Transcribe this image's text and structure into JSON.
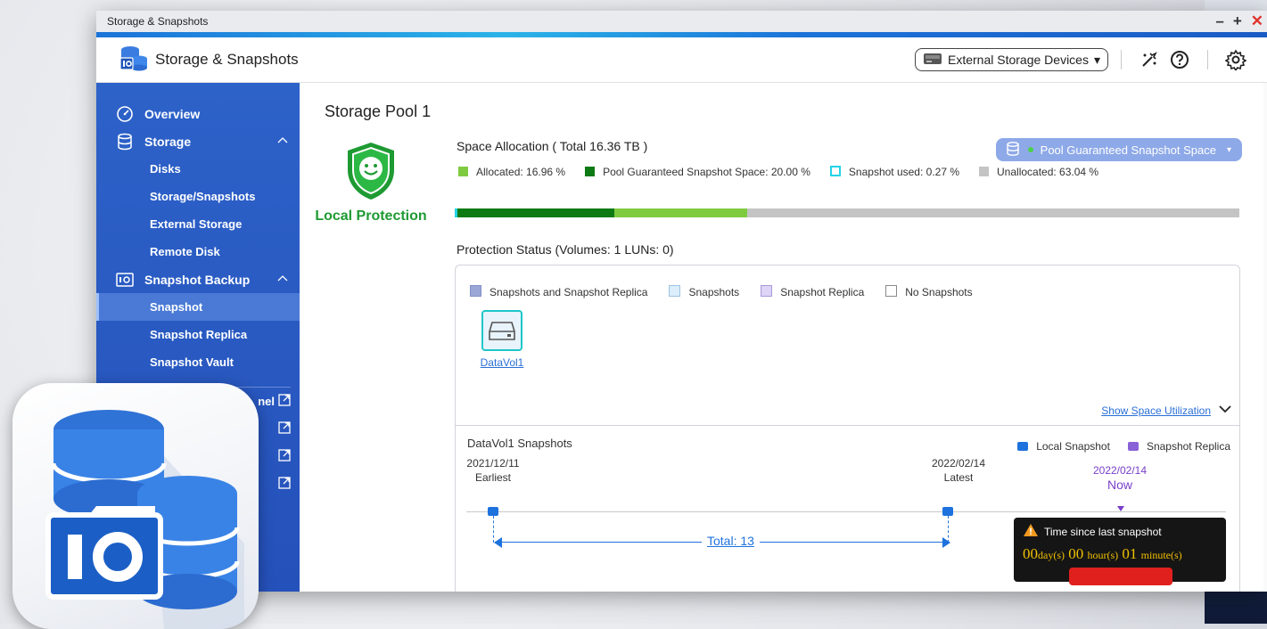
{
  "window": {
    "title": "Storage & Snapshots"
  },
  "window_controls": {
    "minimize": "–",
    "maximize": "+",
    "close": "✕"
  },
  "header": {
    "app_title": "Storage & Snapshots",
    "external_devices_label": "External Storage Devices",
    "dropdown_arrow": "▾"
  },
  "sidebar": {
    "overview": "Overview",
    "storage": "Storage",
    "storage_items": [
      "Disks",
      "Storage/Snapshots",
      "External Storage",
      "Remote Disk"
    ],
    "snapshot_backup": "Snapshot Backup",
    "snapshot_items": [
      "Snapshot",
      "Snapshot Replica",
      "Snapshot Vault"
    ],
    "active_item": "Snapshot",
    "external_links": [
      "nel",
      "",
      "",
      ""
    ]
  },
  "main": {
    "pool_title": "Storage Pool 1",
    "protection_label": "Local Protection",
    "space_title": "Space Allocation ( Total 16.36 TB )",
    "legend": [
      {
        "label": "Allocated: 16.96 %",
        "color": "#7fcb3f",
        "style": "fill"
      },
      {
        "label": "Pool Guaranteed Snapshot Space: 20.00 %",
        "color": "#0e7a14",
        "style": "fill"
      },
      {
        "label": "Snapshot used: 0.27 %",
        "color": "#22d3e6",
        "style": "outline"
      },
      {
        "label": "Unallocated: 63.04 %",
        "color": "#c4c4c4",
        "style": "fill"
      }
    ],
    "allocation_bar": [
      {
        "name": "snapshot-used",
        "percent": 0.27,
        "color": "#22d3e6"
      },
      {
        "name": "pool-guaranteed",
        "percent": 20.0,
        "color": "#0e7a14"
      },
      {
        "name": "allocated",
        "percent": 16.96,
        "color": "#7fcb3f"
      }
    ],
    "pool_button": "Pool Guaranteed Snapshot Space",
    "protection_title": "Protection Status (Volumes: 1 LUNs: 0)",
    "volume_legend": [
      {
        "label": "Snapshots and Snapshot Replica",
        "fill": "#9aa7d6",
        "border": "#8290c6"
      },
      {
        "label": "Snapshots",
        "fill": "#dceefb",
        "border": "#9cc3e3"
      },
      {
        "label": "Snapshot Replica",
        "fill": "#ddd4f6",
        "border": "#a89ad9"
      },
      {
        "label": "No Snapshots",
        "fill": "#ffffff",
        "border": "#8a8a8a"
      }
    ],
    "volume": {
      "name": "DataVol1"
    },
    "show_util": "Show Space Utilization",
    "snapshots": {
      "title": "DataVol1 Snapshots",
      "legend_local": "Local Snapshot",
      "legend_replica": "Snapshot Replica",
      "earliest_date": "2021/12/11",
      "earliest_label": "Earliest",
      "latest_date": "2022/02/14",
      "latest_label": "Latest",
      "now_date": "2022/02/14",
      "now_label": "Now",
      "total_label": "Total: 13",
      "tooltip_title": "Time since last snapshot",
      "tooltip_days": "00",
      "tooltip_days_unit": "day(s)",
      "tooltip_hours": "00",
      "tooltip_hours_unit": "hour(s)",
      "tooltip_minutes": "01",
      "tooltip_minutes_unit": "minute(s)"
    }
  },
  "colors": {
    "accent": "#2d62c9",
    "protect_green": "#1e9a32",
    "link_blue": "#2a6fd6",
    "replica_purple": "#7a3fc9"
  }
}
